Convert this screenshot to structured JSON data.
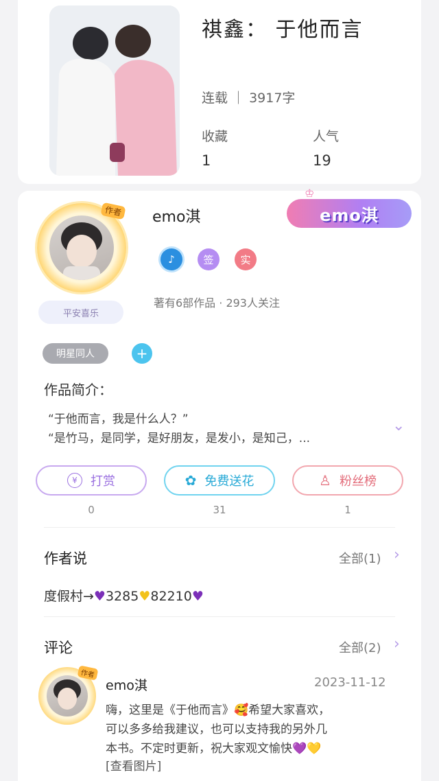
{
  "book": {
    "title": "祺鑫： 于他而言",
    "serial_info": "连载 ｜ 3917字",
    "collect_label": "收藏",
    "collect_value": "1",
    "popularity_label": "人气",
    "popularity_value": "19"
  },
  "author": {
    "name": "emo淇",
    "role_tag": "作者",
    "frame_text": "平安喜乐",
    "brand_badge": "emo淇",
    "badges": [
      {
        "icon": "music-note-icon",
        "text": "♪",
        "color": "#2b8fe0"
      },
      {
        "icon": "sign-badge",
        "text": "签",
        "color": "#b58df2"
      },
      {
        "icon": "verified-badge",
        "text": "实",
        "color": "#f27b86"
      }
    ],
    "works_info": "著有6部作品 · 293人关注"
  },
  "tags": {
    "category": "明星同人",
    "add": "+"
  },
  "intro": {
    "label": "作品简介：",
    "line1": "“于他而言，我是什么人？”",
    "line2": "“是竹马，是同学，是好朋友，是发小，是知己，..."
  },
  "actions": [
    {
      "label": "打赏",
      "icon": "yen-icon",
      "count": "0"
    },
    {
      "label": "免费送花",
      "icon": "flower-icon",
      "count": "31"
    },
    {
      "label": "粉丝榜",
      "icon": "fans-icon",
      "count": "1"
    }
  ],
  "author_say": {
    "title": "作者说",
    "more": "全部(1)",
    "content_prefix": "度假村→",
    "content_num1": "3285",
    "content_num2": "82210"
  },
  "comments": {
    "title": "评论",
    "more": "全部(2)",
    "items": [
      {
        "name": "emo淇",
        "date": "2023-11-12",
        "line1": "嗨，这里是《于他而言》🥰希望大家喜欢，",
        "line2": "可以多多给我建议，也可以支持我的另外几",
        "line3": "本书。不定时更新，祝大家观文愉快💜💛",
        "view_image": "[查看图片]"
      }
    ]
  },
  "colors": {
    "accent_purple": "#9a6fe0",
    "accent_cyan": "#27a9d6",
    "accent_pink": "#e36c7a"
  }
}
